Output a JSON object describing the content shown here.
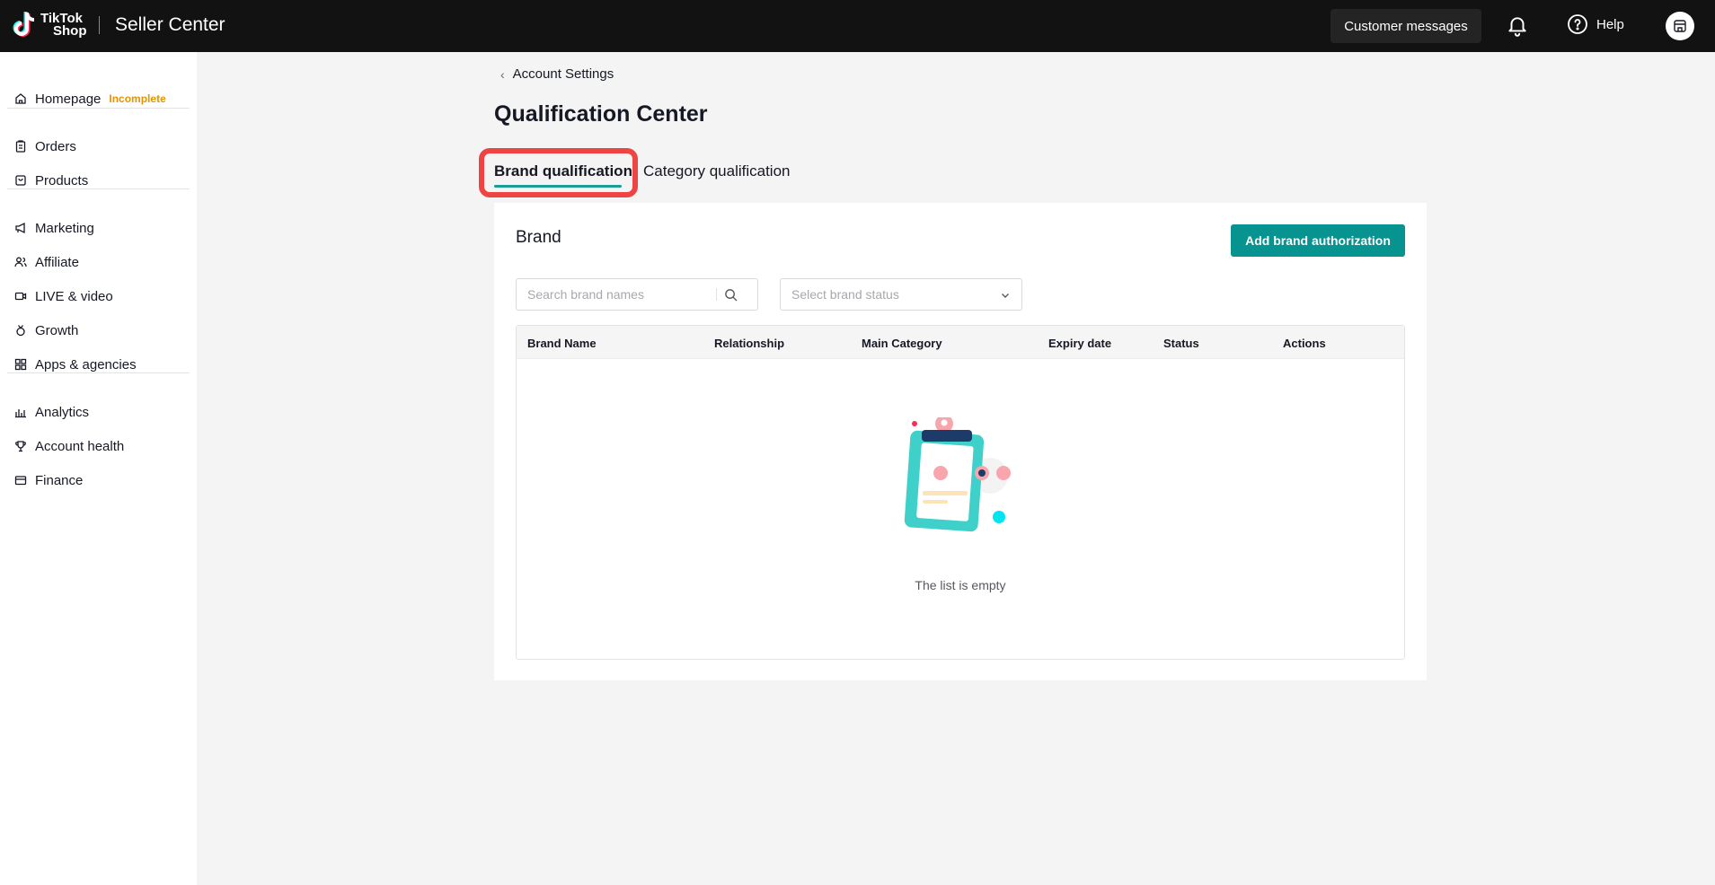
{
  "topbar": {
    "logo_line1": "TikTok",
    "logo_line2": "Shop",
    "app_title": "Seller Center",
    "customer_messages": "Customer messages",
    "help": "Help"
  },
  "sidebar": {
    "items": [
      {
        "label": "Homepage",
        "badge": "Incomplete",
        "icon": "home-icon"
      },
      {
        "label": "Orders",
        "icon": "clipboard-icon"
      },
      {
        "label": "Products",
        "icon": "bag-icon"
      },
      {
        "label": "Marketing",
        "icon": "megaphone-icon"
      },
      {
        "label": "Affiliate",
        "icon": "people-icon"
      },
      {
        "label": "LIVE & video",
        "icon": "video-icon"
      },
      {
        "label": "Growth",
        "icon": "medal-icon"
      },
      {
        "label": "Apps & agencies",
        "icon": "apps-icon"
      },
      {
        "label": "Analytics",
        "icon": "chart-icon"
      },
      {
        "label": "Account health",
        "icon": "trophy-icon"
      },
      {
        "label": "Finance",
        "icon": "wallet-icon"
      }
    ]
  },
  "main": {
    "breadcrumb": "Account Settings",
    "page_title": "Qualification Center",
    "tabs": [
      {
        "label": "Brand qualification",
        "active": true
      },
      {
        "label": "Category qualification",
        "active": false
      }
    ],
    "card": {
      "title": "Brand",
      "add_button": "Add brand authorization",
      "search_placeholder": "Search brand names",
      "status_placeholder": "Select brand status",
      "columns": [
        "Brand Name",
        "Relationship",
        "Main Category",
        "Expiry date",
        "Status",
        "Actions"
      ],
      "empty_text": "The list is empty"
    }
  },
  "colors": {
    "accent": "#079390",
    "highlight": "#ef4444",
    "badge": "#e39400",
    "topbar": "#121212"
  }
}
